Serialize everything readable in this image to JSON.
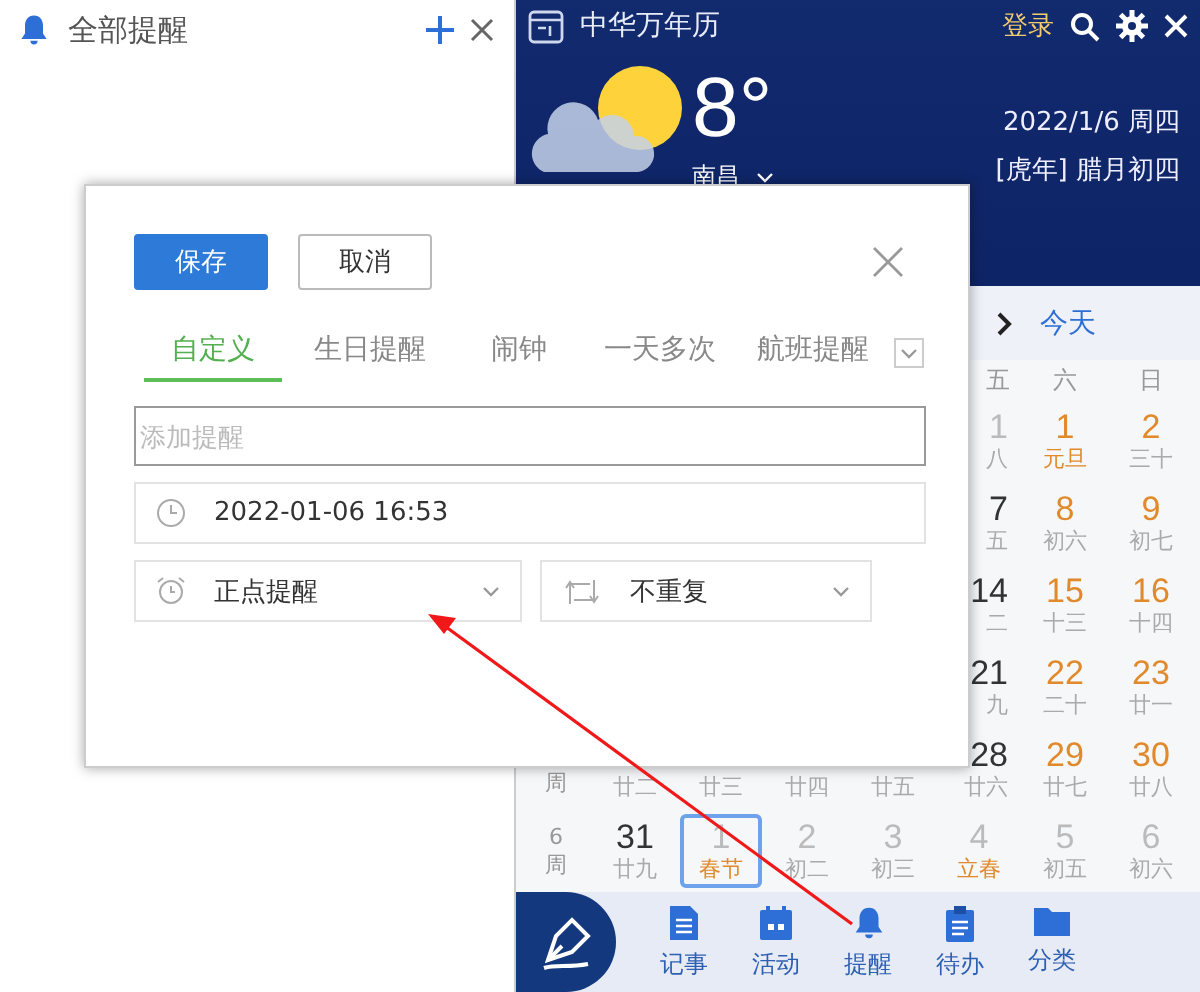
{
  "reminders_panel": {
    "title": "全部提醒"
  },
  "calendar": {
    "title": "中华万年历",
    "login": "登录",
    "weather": {
      "temperature": "8°",
      "city": "南昌"
    },
    "date": "2022/1/6 周四",
    "lunar_date": "[虎年] 腊月初四",
    "today_button": "今天",
    "weekdays": [
      "五",
      "六",
      "日"
    ],
    "rows": [
      {
        "cells": [
          {
            "day": "1",
            "lunar": "八",
            "kind": "muted",
            "festival": false,
            "selected": false
          },
          {
            "day": "1",
            "lunar": "元旦",
            "kind": "weekend",
            "festival": true,
            "selected": false
          },
          {
            "day": "2",
            "lunar": "三十",
            "kind": "weekend",
            "festival": false,
            "selected": false
          }
        ]
      },
      {
        "cells": [
          {
            "day": "7",
            "lunar": "五",
            "kind": "normal",
            "festival": false,
            "selected": false
          },
          {
            "day": "8",
            "lunar": "初六",
            "kind": "weekend",
            "festival": false,
            "selected": false
          },
          {
            "day": "9",
            "lunar": "初七",
            "kind": "weekend",
            "festival": false,
            "selected": false
          }
        ]
      },
      {
        "cells": [
          {
            "day": "14",
            "lunar": "二",
            "kind": "normal",
            "festival": false,
            "selected": false
          },
          {
            "day": "15",
            "lunar": "十三",
            "kind": "weekend",
            "festival": false,
            "selected": false
          },
          {
            "day": "16",
            "lunar": "十四",
            "kind": "weekend",
            "festival": false,
            "selected": false
          }
        ]
      },
      {
        "cells": [
          {
            "day": "21",
            "lunar": "九",
            "kind": "normal",
            "festival": false,
            "selected": false
          },
          {
            "day": "22",
            "lunar": "二十",
            "kind": "weekend",
            "festival": false,
            "selected": false
          },
          {
            "day": "23",
            "lunar": "廿一",
            "kind": "weekend",
            "festival": false,
            "selected": false
          }
        ]
      },
      {
        "week": {
          "label": "周"
        },
        "cells": [
          {
            "lunar": "廿二",
            "festival": false,
            "selected": false
          },
          {
            "lunar": "廿三",
            "festival": false,
            "selected": false
          },
          {
            "lunar": "廿四",
            "festival": false,
            "selected": false
          },
          {
            "lunar": "廿五",
            "festival": false,
            "selected": false
          },
          {
            "day": "28",
            "lunar": "廿六",
            "kind": "normal",
            "festival": false,
            "selected": false
          },
          {
            "day": "29",
            "lunar": "廿七",
            "kind": "weekend",
            "festival": false,
            "selected": false
          },
          {
            "day": "30",
            "lunar": "廿八",
            "kind": "weekend",
            "festival": false,
            "selected": false
          }
        ]
      },
      {
        "week": {
          "number": "6",
          "label": "周"
        },
        "cells": [
          {
            "day": "31",
            "lunar": "廿九",
            "kind": "normal",
            "festival": false,
            "selected": false
          },
          {
            "day": "1",
            "lunar": "春节",
            "kind": "muted",
            "festival": true,
            "selected": true
          },
          {
            "day": "2",
            "lunar": "初二",
            "kind": "muted",
            "festival": false,
            "selected": false
          },
          {
            "day": "3",
            "lunar": "初三",
            "kind": "muted",
            "festival": false,
            "selected": false
          },
          {
            "day": "4",
            "lunar": "立春",
            "kind": "muted",
            "festival": true,
            "selected": false
          },
          {
            "day": "5",
            "lunar": "初五",
            "kind": "muted",
            "festival": false,
            "selected": false
          },
          {
            "day": "6",
            "lunar": "初六",
            "kind": "muted",
            "festival": false,
            "selected": false
          }
        ]
      }
    ],
    "toolbar": [
      {
        "label": "记事",
        "selected": false
      },
      {
        "label": "活动",
        "selected": false
      },
      {
        "label": "提醒",
        "selected": false
      },
      {
        "label": "待办",
        "selected": false
      },
      {
        "label": "分类",
        "selected": false
      }
    ]
  },
  "dialog": {
    "save_button": "保存",
    "cancel_button": "取消",
    "tabs": [
      {
        "label": "自定义",
        "selected": true
      },
      {
        "label": "生日提醒",
        "selected": false
      },
      {
        "label": "闹钟",
        "selected": false
      },
      {
        "label": "一天多次",
        "selected": false
      },
      {
        "label": "航班提醒",
        "selected": false
      }
    ],
    "title_field": {
      "placeholder": "添加提醒"
    },
    "datetime_field": {
      "value": "2022-01-06 16:53"
    },
    "alert_select": {
      "value": "正点提醒"
    },
    "repeat_select": {
      "value": "不重复"
    }
  }
}
